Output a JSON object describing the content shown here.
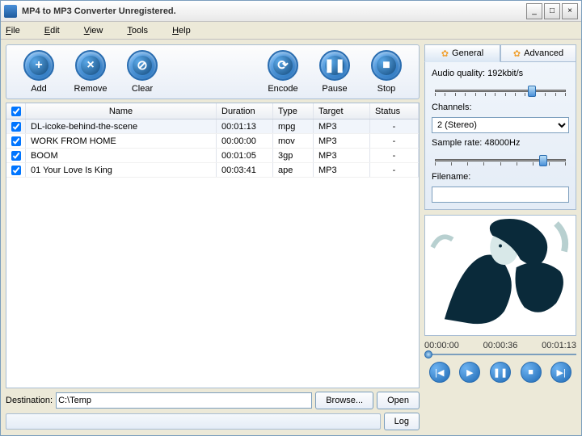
{
  "title": "MP4 to MP3 Converter Unregistered.",
  "menu": [
    "File",
    "Edit",
    "View",
    "Tools",
    "Help"
  ],
  "toolbar": {
    "add": "Add",
    "remove": "Remove",
    "clear": "Clear",
    "encode": "Encode",
    "pause": "Pause",
    "stop": "Stop"
  },
  "columns": {
    "name": "Name",
    "duration": "Duration",
    "type": "Type",
    "target": "Target",
    "status": "Status"
  },
  "rows": [
    {
      "name": "DL-icoke-behind-the-scene",
      "duration": "00:01:13",
      "type": "mpg",
      "target": "MP3",
      "status": "-",
      "checked": true,
      "sel": true
    },
    {
      "name": "WORK FROM HOME",
      "duration": "00:00:00",
      "type": "mov",
      "target": "MP3",
      "status": "-",
      "checked": true
    },
    {
      "name": "BOOM",
      "duration": "00:01:05",
      "type": "3gp",
      "target": "MP3",
      "status": "-",
      "checked": true
    },
    {
      "name": "01 Your Love Is King",
      "duration": "00:03:41",
      "type": "ape",
      "target": "MP3",
      "status": "-",
      "checked": true
    }
  ],
  "dest": {
    "label": "Destination:",
    "value": "C:\\Temp",
    "browse": "Browse...",
    "open": "Open"
  },
  "log": "Log",
  "tabs": {
    "general": "General",
    "advanced": "Advanced"
  },
  "settings": {
    "quality_label": "Audio quality:",
    "quality_value": "192kbit/s",
    "channels_label": "Channels:",
    "channels_value": "2 (Stereo)",
    "sample_label": "Sample rate:",
    "sample_value": "48000Hz",
    "filename_label": "Filename:",
    "filename_value": ""
  },
  "player": {
    "t0": "00:00:00",
    "t1": "00:00:36",
    "t2": "00:01:13"
  }
}
